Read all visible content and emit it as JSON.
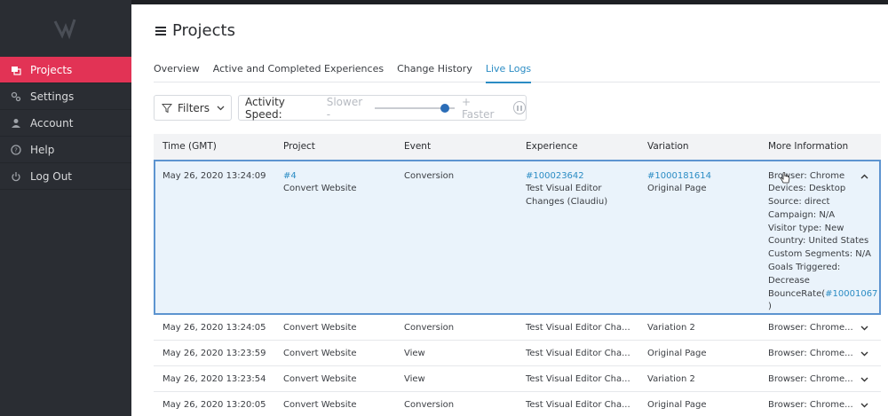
{
  "app": {
    "page_title": "Projects",
    "brand_color": "#e23355",
    "link_color": "#2b8cc4"
  },
  "sidebar": {
    "items": [
      {
        "label": "Projects",
        "icon": "projects-icon",
        "active": true
      },
      {
        "label": "Settings",
        "icon": "gear-icon",
        "active": false
      },
      {
        "label": "Account",
        "icon": "user-icon",
        "active": false
      },
      {
        "label": "Help",
        "icon": "help-icon",
        "active": false
      },
      {
        "label": "Log Out",
        "icon": "power-icon",
        "active": false
      }
    ]
  },
  "tabs": [
    {
      "label": "Overview",
      "active": false
    },
    {
      "label": "Active and Completed Experiences",
      "active": false
    },
    {
      "label": "Change History",
      "active": false
    },
    {
      "label": "Live Logs",
      "active": true
    }
  ],
  "toolbar": {
    "filters_label": "Filters",
    "speed_label": "Activity Speed:",
    "slower_label": "Slower -",
    "faster_label": "+ Faster",
    "speed_level": 0.93
  },
  "table": {
    "columns": [
      "Time (GMT)",
      "Project",
      "Event",
      "Experience",
      "Variation",
      "More Information"
    ],
    "expanded_row": {
      "time": "May 26, 2020 13:24:09",
      "project_id": "#4",
      "project_name": "Convert Website",
      "event": "Conversion",
      "experience_id": "#100023642",
      "experience_line1": "Test Visual Editor",
      "experience_line2": "Changes (Claudiu)",
      "variation_id": "#1000181614",
      "variation_name": "Original Page",
      "info": {
        "browser": "Browser: Chrome",
        "devices": "Devices: Desktop",
        "source": "Source: direct",
        "campaign": "Campaign: N/A",
        "visitor_type": "Visitor type: New",
        "country": "Country: United States",
        "custom_segments": "Custom Segments: N/A",
        "goals": "Goals Triggered:",
        "goal_name": "Decrease",
        "goal_prefix": "BounceRate(",
        "goal_id": "#10001067",
        "goal_suffix": ")"
      }
    },
    "rows": [
      {
        "time": "May 26, 2020 13:24:05",
        "project": "Convert Website",
        "event": "Conversion",
        "experience": "Test Visual Editor Cha...",
        "variation": "Variation 2",
        "info": "Browser: Chrome..."
      },
      {
        "time": "May 26, 2020 13:23:59",
        "project": "Convert Website",
        "event": "View",
        "experience": "Test Visual Editor Cha...",
        "variation": "Original Page",
        "info": "Browser: Chrome..."
      },
      {
        "time": "May 26, 2020 13:23:54",
        "project": "Convert Website",
        "event": "View",
        "experience": "Test Visual Editor Cha...",
        "variation": "Variation 2",
        "info": "Browser: Chrome..."
      },
      {
        "time": "May 26, 2020 13:20:05",
        "project": "Convert Website",
        "event": "Conversion",
        "experience": "Test Visual Editor Cha...",
        "variation": "Original Page",
        "info": "Browser: Chrome..."
      }
    ]
  }
}
